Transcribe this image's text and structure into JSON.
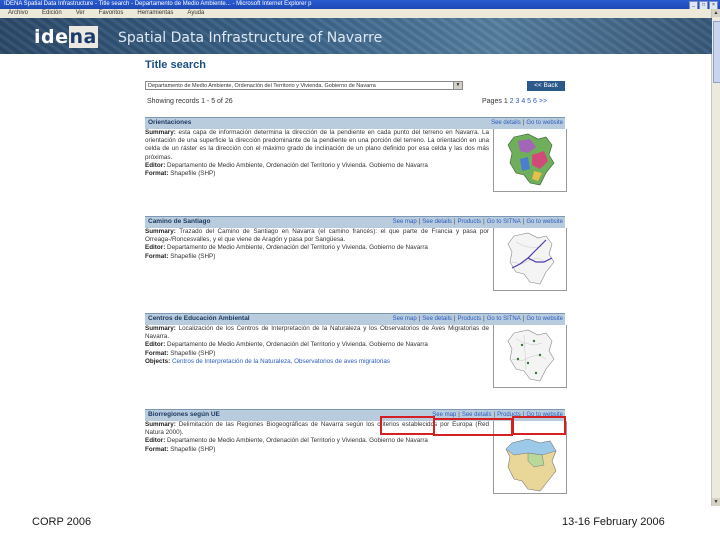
{
  "window": {
    "title": "IDENA  Spatial Data Infrastructure - Title search - Departamento de Medio Ambiente... - Microsoft Internet Explorer p"
  },
  "menu": [
    "Archivo",
    "Edición",
    "Ver",
    "Favoritos",
    "Herramientas",
    "Ayuda"
  ],
  "banner": {
    "logo_a": "ide",
    "logo_b": "na",
    "subtitle": "Spatial Data Infrastructure of Navarre"
  },
  "page": {
    "title": "Title search",
    "select_value": "Departamento de Medio Ambiente, Ordenación del Territorio y Vivienda. Gobierno de Navarra",
    "back_label": "<< Back",
    "showing": "Showing records 1 - 5 of 26",
    "pages_label": "Pages",
    "pages_current": "1",
    "pages_links": "2 3 4 5 6 >>"
  },
  "results": [
    {
      "name": "Orientaciones",
      "links": [
        "See details",
        "Go to website"
      ],
      "summary": "esta capa de información determina la dirección de la pendiente en cada punto del terreno en Navarra. La orientación de una superficie la dirección predominante de la pendiente en una porción del terreno. La orientación en una celda de un ráster es la dirección con el máximo grado de inclinación de un plano definido por esa celda y las dos más próximas.",
      "editor": "Departamento de Medio Ambiente, Ordenación del Territorio y Vivienda. Gobierno de Navarra",
      "format": "Shapefile (SHP)"
    },
    {
      "name": "Camino de Santiago",
      "links": [
        "See map",
        "See details",
        "Products",
        "Go to SITNA",
        "Go to website"
      ],
      "summary": "Trazado del Camino de Santiago en Navarra (el camino francés): el que parte de Francia y pasa por Orreaga-/Roncesvalles, y el que viene de Aragón y pasa por Sangüesa.",
      "editor": "Departamento de Medio Ambiente, Ordenación del Territorio y Vivienda. Gobierno de Navarra",
      "format": "Shapefile (SHP)"
    },
    {
      "name": "Centros de Educación Ambiental",
      "links": [
        "See map",
        "See details",
        "Products",
        "Go to SITNA",
        "Go to website"
      ],
      "summary": "Localización de los Centros de Interpretación de la Naturaleza y los Observatorios de Aves Migratorias de Navarra.",
      "editor": "Departamento de Medio Ambiente, Ordenación del Territorio y Vivienda. Gobierno de Navarra",
      "format": "Shapefile (SHP)",
      "objects": "Centros de Interpretación de la Naturaleza, Observatorios de aves migratorias"
    },
    {
      "name": "Biorregiones según UE",
      "links": [
        "See map",
        "See details",
        "Products",
        "Go to website"
      ],
      "summary": "Delimitación de las Regiones Biogeográficas de Navarra según los criterios establecidos por Europa (Red Natura 2000).",
      "editor": "Departamento de Medio Ambiente, Ordenación del Territorio y Vivienda. Gobierno de Navarra",
      "format": "Shapefile (SHP)"
    }
  ],
  "labels": {
    "summary": "Summary:",
    "editor": "Editor:",
    "format": "Format:",
    "objects": "Objects:"
  },
  "footer": {
    "left": "CORP 2006",
    "right": "13-16 February 2006"
  }
}
